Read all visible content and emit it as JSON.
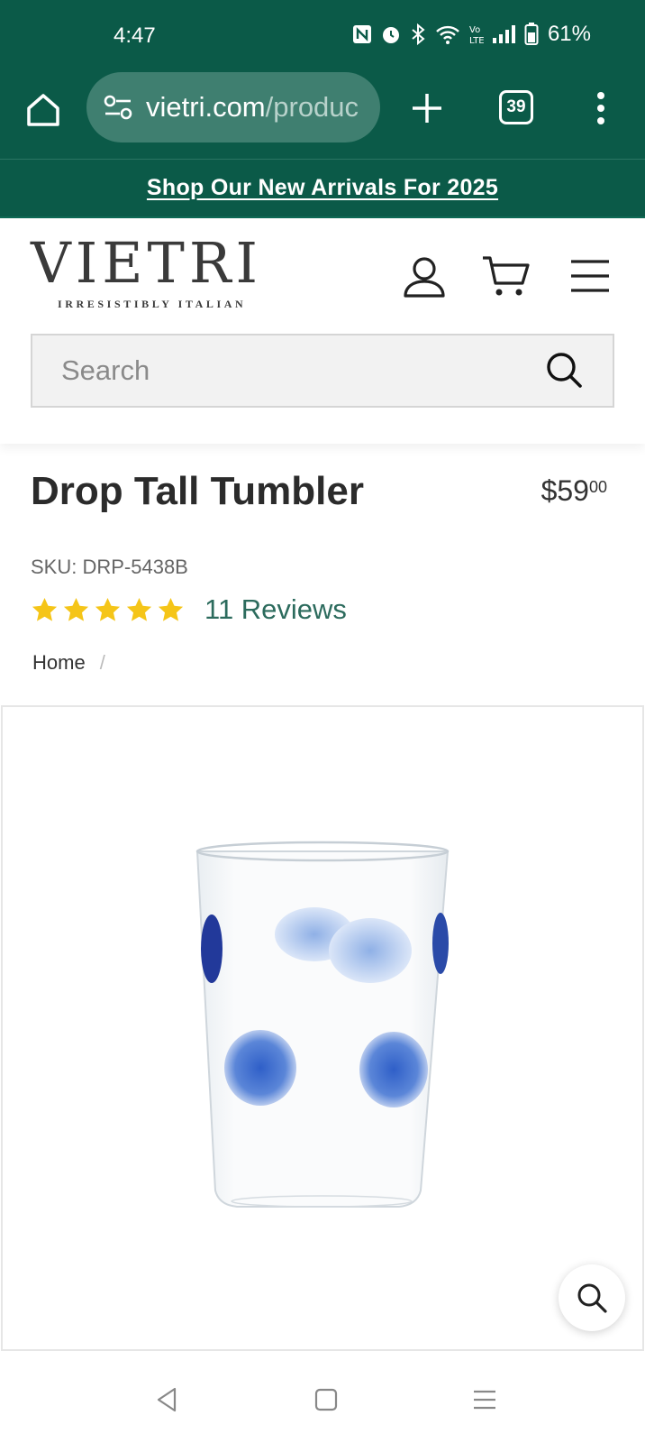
{
  "status": {
    "time": "4:47",
    "battery": "61%",
    "icons": [
      "nfc-icon",
      "alarm-icon",
      "bluetooth-icon",
      "wifi-icon",
      "volte-icon",
      "signal-icon",
      "battery-icon"
    ]
  },
  "browser": {
    "url_host": "vietri.com",
    "url_path": "/produc",
    "tab_count": "39"
  },
  "announcement": {
    "text": "Shop Our New Arrivals For 2025"
  },
  "header": {
    "logo": "VIETRI",
    "tagline": "IRRESISTIBLY ITALIAN",
    "search_placeholder": "Search"
  },
  "product": {
    "title": "Drop Tall Tumbler",
    "price_dollars": "$59",
    "price_cents": "00",
    "sku": "SKU: DRP-5438B",
    "rating_stars": 5,
    "reviews": "11 Reviews"
  },
  "breadcrumb": {
    "home": "Home",
    "separator": "/"
  },
  "colors": {
    "brand_green": "#0b5a48",
    "star_yellow": "#f5c518",
    "reviews_link": "#2c6b5d"
  }
}
